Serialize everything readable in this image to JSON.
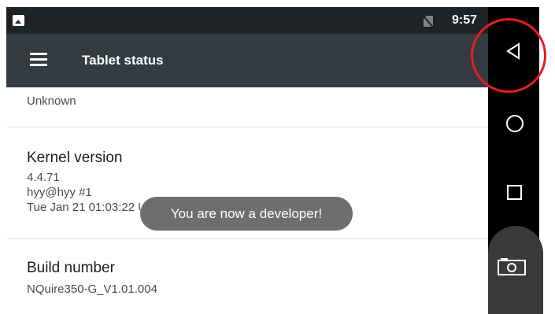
{
  "status_bar": {
    "time": "9:57"
  },
  "toolbar": {
    "title": "Tablet status"
  },
  "rows": {
    "prev_value": "Unknown",
    "kernel": {
      "title": "Kernel version",
      "line1": "4.4.71",
      "line2": "hyy@hyy #1",
      "line3": "Tue Jan 21 01:03:22 UTC 2020"
    },
    "build": {
      "title": "Build number",
      "value": "NQuire350-G_V1.01.004"
    }
  },
  "toast": "You are now a developer!",
  "navbar": {
    "icons": [
      "back-icon",
      "home-icon",
      "recents-icon",
      "camera-icon"
    ]
  },
  "colors": {
    "status_bar": "#1f2326",
    "toolbar": "#343c42",
    "navbar": "#000000",
    "toast": "#6e6e6e",
    "annotation": "#e51c23"
  }
}
